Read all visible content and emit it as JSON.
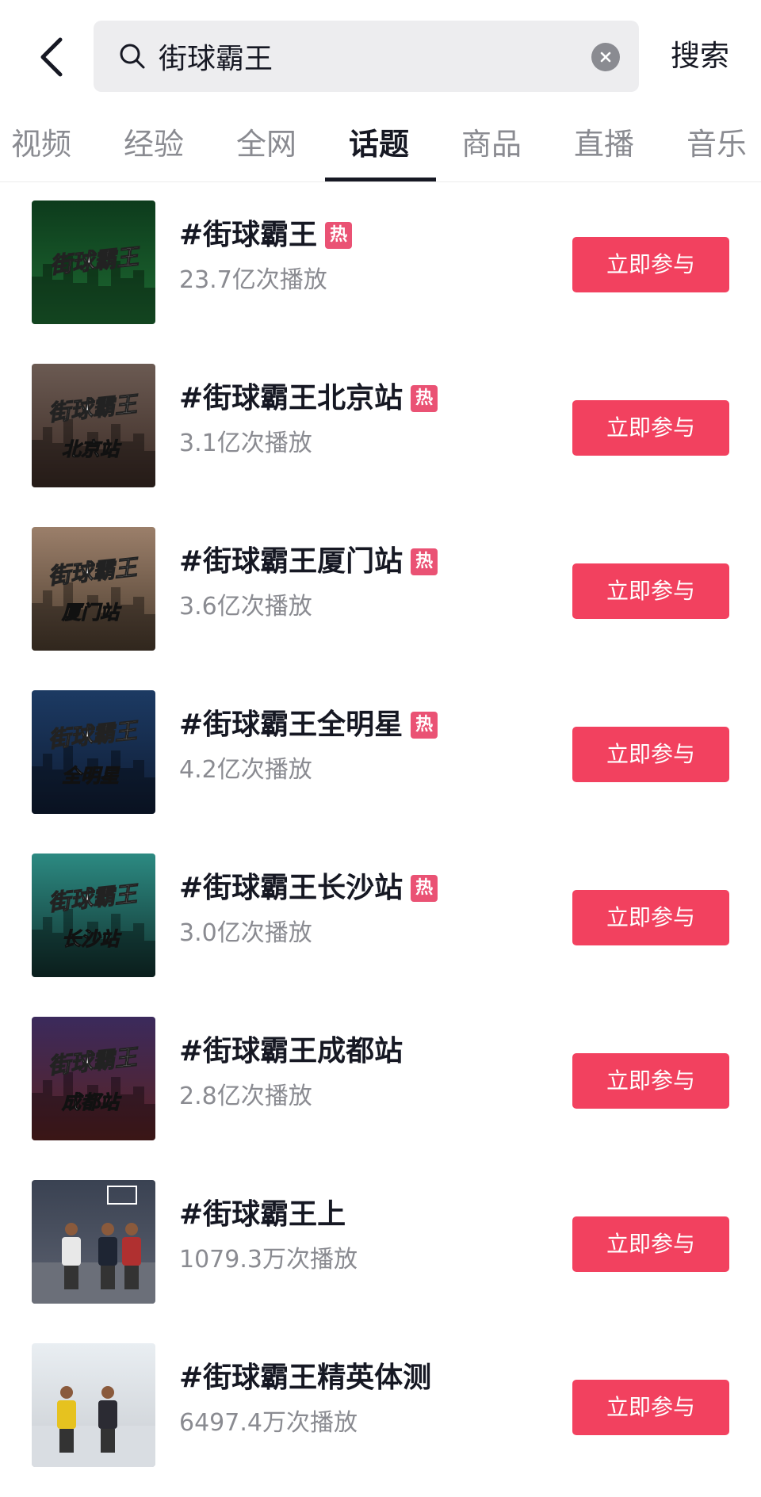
{
  "header": {
    "search_value": "街球霸王",
    "search_button": "搜索"
  },
  "tabs": [
    {
      "label": "视频"
    },
    {
      "label": "经验"
    },
    {
      "label": "全网"
    },
    {
      "label": "话题",
      "active": true
    },
    {
      "label": "商品"
    },
    {
      "label": "直播"
    },
    {
      "label": "音乐"
    }
  ],
  "topics": [
    {
      "title": "#街球霸王",
      "hot": true,
      "hot_label": "热",
      "plays": "23.7亿次播放",
      "join_label": "立即参与",
      "thumb_text": "街球霸王",
      "thumb_sub": "",
      "thumb_colors": [
        "#0d3b1c",
        "#1e6a32"
      ]
    },
    {
      "title": "#街球霸王北京站",
      "hot": true,
      "hot_label": "热",
      "plays": "3.1亿次播放",
      "join_label": "立即参与",
      "thumb_text": "街球霸王",
      "thumb_sub": "北京站",
      "thumb_colors": [
        "#6b5a52",
        "#3a2a24"
      ]
    },
    {
      "title": "#街球霸王厦门站",
      "hot": true,
      "hot_label": "热",
      "plays": "3.6亿次播放",
      "join_label": "立即参与",
      "thumb_text": "街球霸王",
      "thumb_sub": "厦门站",
      "thumb_colors": [
        "#9b7f6a",
        "#4b3c2e"
      ]
    },
    {
      "title": "#街球霸王全明星",
      "hot": true,
      "hot_label": "热",
      "plays": "4.2亿次播放",
      "join_label": "立即参与",
      "thumb_text": "街球霸王",
      "thumb_sub": "全明星",
      "thumb_colors": [
        "#1c3a63",
        "#0f1c33"
      ]
    },
    {
      "title": "#街球霸王长沙站",
      "hot": true,
      "hot_label": "热",
      "plays": "3.0亿次播放",
      "join_label": "立即参与",
      "thumb_text": "街球霸王",
      "thumb_sub": "长沙站",
      "thumb_colors": [
        "#2c8a82",
        "#11302d"
      ]
    },
    {
      "title": "#街球霸王成都站",
      "hot": false,
      "hot_label": "",
      "plays": "2.8亿次播放",
      "join_label": "立即参与",
      "thumb_text": "街球霸王",
      "thumb_sub": "成都站",
      "thumb_colors": [
        "#3b2a5c",
        "#5a2222"
      ]
    },
    {
      "title": "#街球霸王上",
      "hot": false,
      "hot_label": "",
      "plays": "1079.3万次播放",
      "join_label": "立即参与",
      "thumb_text": "",
      "thumb_sub": "",
      "thumb_colors": [
        "#3a4252",
        "#5d6270"
      ]
    },
    {
      "title": "#街球霸王精英体测",
      "hot": false,
      "hot_label": "",
      "plays": "6497.4万次播放",
      "join_label": "立即参与",
      "thumb_text": "",
      "thumb_sub": "",
      "thumb_colors": [
        "#e9eef2",
        "#c9cdd2"
      ]
    }
  ],
  "colors": {
    "accent": "#f2415f",
    "hot": "#ea5274",
    "text_primary": "#161823",
    "text_secondary": "#8a8b91"
  }
}
